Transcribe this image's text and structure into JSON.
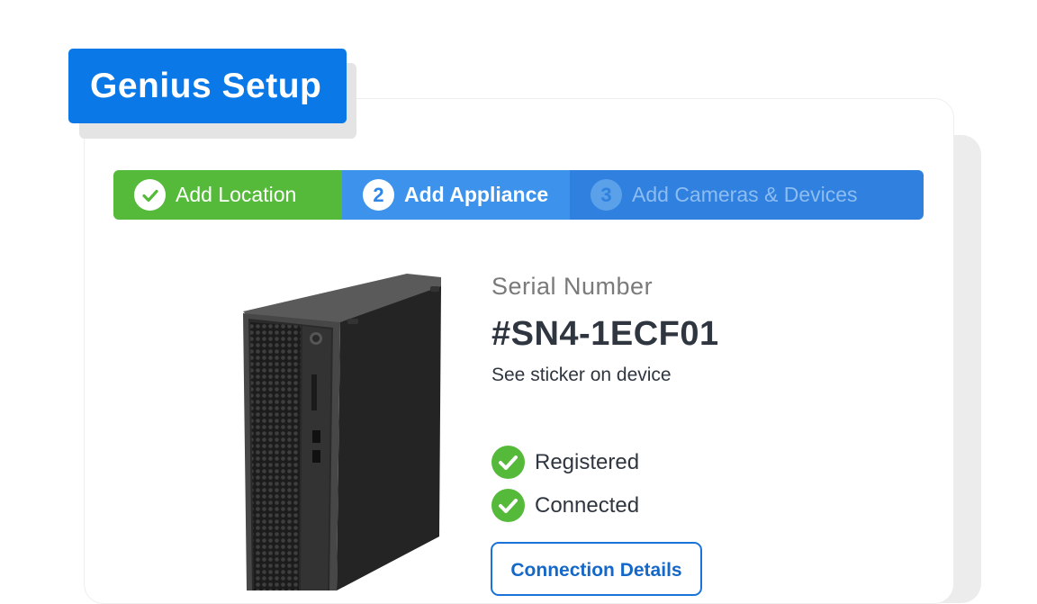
{
  "header": {
    "title": "Genius Setup"
  },
  "stepper": {
    "steps": [
      {
        "number": "1",
        "label": "Add Location",
        "state": "completed",
        "icon": "check-icon"
      },
      {
        "number": "2",
        "label": "Add Appliance",
        "state": "active"
      },
      {
        "number": "3",
        "label": "Add Cameras & Devices",
        "state": "upcoming"
      }
    ]
  },
  "device": {
    "image_description": "appliance-tower-image",
    "serial_label": "Serial Number",
    "serial_value": "#SN4-1ECF01",
    "serial_hint": "See sticker on device"
  },
  "statuses": [
    {
      "label": "Registered",
      "icon": "check-circle-icon"
    },
    {
      "label": "Connected",
      "icon": "check-circle-icon"
    }
  ],
  "actions": {
    "connection_details_label": "Connection Details"
  },
  "colors": {
    "brand_blue": "#0a78e6",
    "step_complete": "#55ba3a",
    "step_active": "#3d93ec",
    "step_upcoming": "#2f80df",
    "success_green": "#55ba3a"
  }
}
